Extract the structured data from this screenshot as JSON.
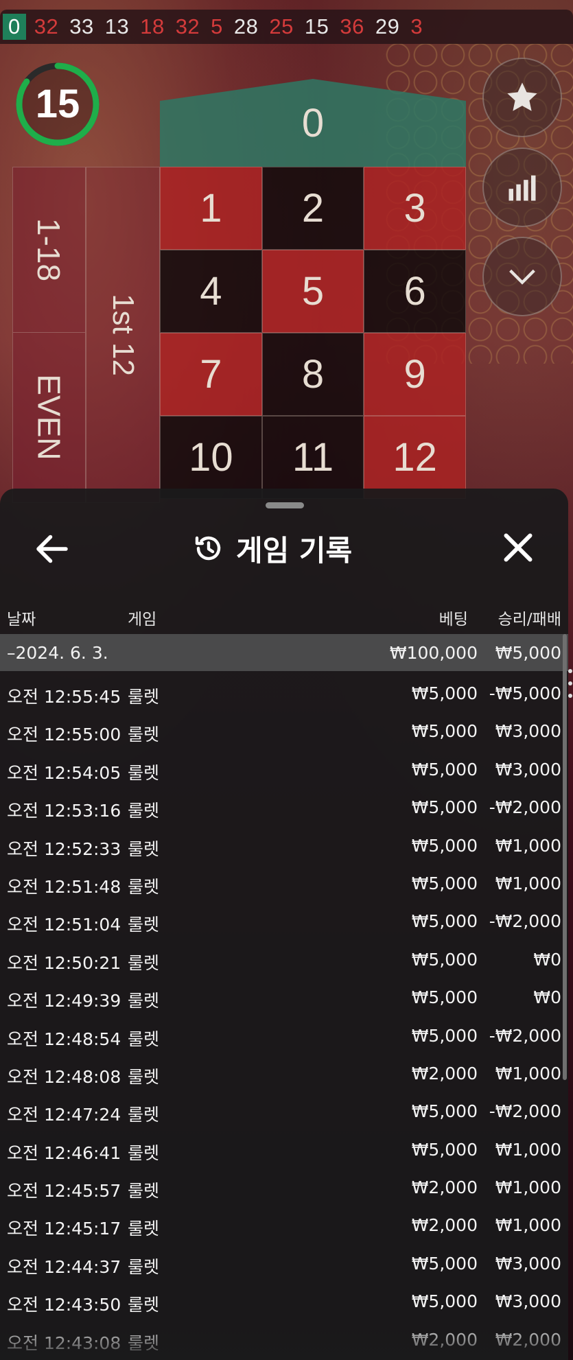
{
  "number_strip": [
    {
      "n": "0",
      "c": "green"
    },
    {
      "n": "32",
      "c": "red"
    },
    {
      "n": "33",
      "c": "black"
    },
    {
      "n": "13",
      "c": "black"
    },
    {
      "n": "18",
      "c": "red"
    },
    {
      "n": "32",
      "c": "red"
    },
    {
      "n": "5",
      "c": "red"
    },
    {
      "n": "28",
      "c": "black"
    },
    {
      "n": "25",
      "c": "red"
    },
    {
      "n": "15",
      "c": "black"
    },
    {
      "n": "36",
      "c": "red"
    },
    {
      "n": "29",
      "c": "black"
    },
    {
      "n": "3",
      "c": "red"
    }
  ],
  "timer": {
    "value": "15",
    "progress": 0.85,
    "color": "#1fae4a"
  },
  "table": {
    "zero": "0",
    "numbers": [
      {
        "n": "1",
        "c": "red"
      },
      {
        "n": "2",
        "c": "black"
      },
      {
        "n": "3",
        "c": "red"
      },
      {
        "n": "4",
        "c": "black"
      },
      {
        "n": "5",
        "c": "red"
      },
      {
        "n": "6",
        "c": "black"
      },
      {
        "n": "7",
        "c": "red"
      },
      {
        "n": "8",
        "c": "black"
      },
      {
        "n": "9",
        "c": "red"
      },
      {
        "n": "10",
        "c": "black"
      },
      {
        "n": "11",
        "c": "black"
      },
      {
        "n": "12",
        "c": "red"
      }
    ],
    "low_label": "1-18",
    "even_label": "EVEN",
    "dozen_label": "1st 12"
  },
  "side_buttons": [
    "star-icon",
    "stats-icon",
    "chevron-down-icon"
  ],
  "history": {
    "title": "게임 기록",
    "columns": {
      "date": "날짜",
      "game": "게임",
      "bet": "베팅",
      "result": "승리/패배"
    },
    "date_row": {
      "date": "–2024. 6. 3.",
      "bet": "₩100,000",
      "result": "₩5,000"
    },
    "rows": [
      {
        "time": "오전 12:55:45",
        "game": "룰렛",
        "bet": "₩5,000",
        "result": "-₩5,000"
      },
      {
        "time": "오전 12:55:00",
        "game": "룰렛",
        "bet": "₩5,000",
        "result": "₩3,000"
      },
      {
        "time": "오전 12:54:05",
        "game": "룰렛",
        "bet": "₩5,000",
        "result": "₩3,000"
      },
      {
        "time": "오전 12:53:16",
        "game": "룰렛",
        "bet": "₩5,000",
        "result": "-₩2,000"
      },
      {
        "time": "오전 12:52:33",
        "game": "룰렛",
        "bet": "₩5,000",
        "result": "₩1,000"
      },
      {
        "time": "오전 12:51:48",
        "game": "룰렛",
        "bet": "₩5,000",
        "result": "₩1,000"
      },
      {
        "time": "오전 12:51:04",
        "game": "룰렛",
        "bet": "₩5,000",
        "result": "-₩2,000"
      },
      {
        "time": "오전 12:50:21",
        "game": "룰렛",
        "bet": "₩5,000",
        "result": "₩0"
      },
      {
        "time": "오전 12:49:39",
        "game": "룰렛",
        "bet": "₩5,000",
        "result": "₩0"
      },
      {
        "time": "오전 12:48:54",
        "game": "룰렛",
        "bet": "₩5,000",
        "result": "-₩2,000"
      },
      {
        "time": "오전 12:48:08",
        "game": "룰렛",
        "bet": "₩2,000",
        "result": "₩1,000"
      },
      {
        "time": "오전 12:47:24",
        "game": "룰렛",
        "bet": "₩5,000",
        "result": "-₩2,000"
      },
      {
        "time": "오전 12:46:41",
        "game": "룰렛",
        "bet": "₩5,000",
        "result": "₩1,000"
      },
      {
        "time": "오전 12:45:57",
        "game": "룰렛",
        "bet": "₩2,000",
        "result": "₩1,000"
      },
      {
        "time": "오전 12:45:17",
        "game": "룰렛",
        "bet": "₩2,000",
        "result": "₩1,000"
      },
      {
        "time": "오전 12:44:37",
        "game": "룰렛",
        "bet": "₩5,000",
        "result": "₩3,000"
      },
      {
        "time": "오전 12:43:50",
        "game": "룰렛",
        "bet": "₩5,000",
        "result": "₩3,000"
      },
      {
        "time": "오전 12:43:08",
        "game": "룰렛",
        "bet": "₩2,000",
        "result": "₩2,000"
      }
    ]
  }
}
